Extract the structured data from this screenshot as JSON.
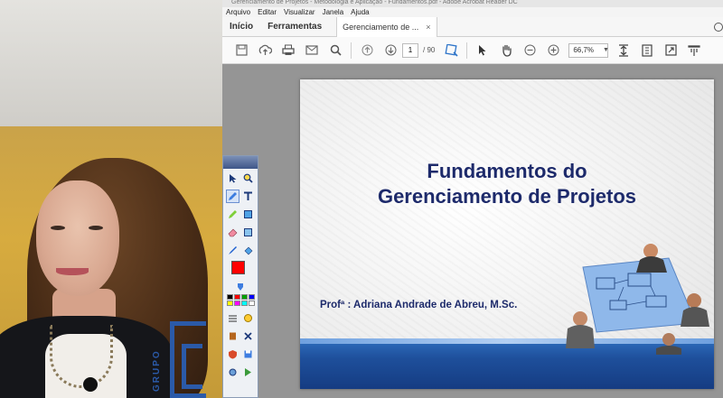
{
  "window": {
    "title": "Gerenciamento de Projetos - Metodologia e Aplicação - Fundamentos.pdf - Adobe Acrobat Reader DC"
  },
  "menu": {
    "items": [
      "Arquivo",
      "Editar",
      "Visualizar",
      "Janela",
      "Ajuda"
    ]
  },
  "nav": {
    "home": "Início",
    "tools": "Ferramentas",
    "doc_tab": "Gerenciamento de ...",
    "doc_tab_close": "×"
  },
  "toolbar": {
    "page_current": "1",
    "page_total": "/ 90",
    "zoom": "66,7%",
    "icons": [
      "save-icon",
      "upload-icon",
      "print-icon",
      "email-icon",
      "search-icon",
      "page-up-icon",
      "page-down-icon",
      "select-icon",
      "hand-icon",
      "zoom-out-icon",
      "zoom-in-icon",
      "fit-page-icon",
      "scroll-icon",
      "fullscreen-icon",
      "comment-icon"
    ]
  },
  "slide": {
    "title_line1": "Fundamentos do",
    "title_line2": "Gerenciamento de Projetos",
    "author": "Profª : Adriana Andrade de Abreu, M.Sc."
  },
  "logo": {
    "text": "GRUPO"
  },
  "palette": {
    "active_color": "#ff0000",
    "swatches": [
      "#000000",
      "#ff0000",
      "#00a000",
      "#0000ff",
      "#ffff00",
      "#ff00ff",
      "#00ffff",
      "#ffffff",
      "#808080",
      "#ff8000",
      "#008080",
      "#800080"
    ]
  }
}
